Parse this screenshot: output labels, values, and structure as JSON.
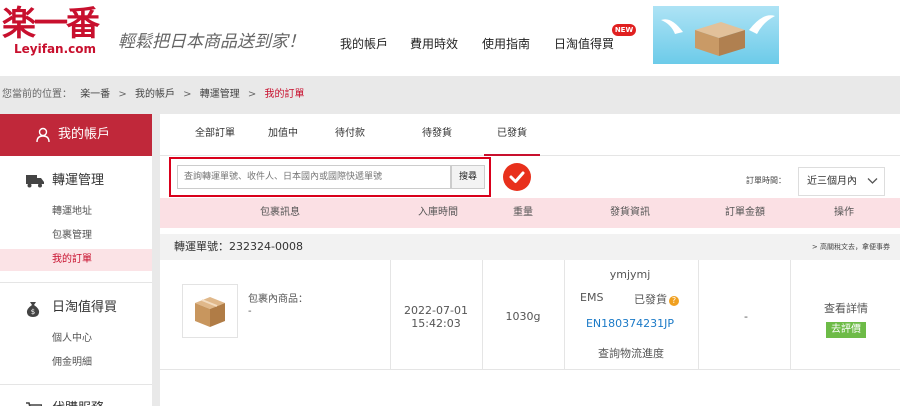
{
  "header": {
    "logo_cn": "楽一番",
    "logo_en": "Leyifan.com",
    "slogan": "輕鬆把日本商品送到家！",
    "nav": [
      {
        "label": "我的帳戶"
      },
      {
        "label": "費用時效"
      },
      {
        "label": "使用指南"
      },
      {
        "label": "日淘值得買"
      }
    ],
    "new_badge": "NEW"
  },
  "breadcrumb": {
    "prefix": "您當前的位置：",
    "items": [
      "楽一番",
      ">",
      "我的帳戶",
      ">",
      "轉運管理",
      ">",
      "我的訂單"
    ]
  },
  "sidebar": {
    "account_label": "我的帳戶",
    "sections": [
      {
        "label": "轉運管理",
        "items": [
          "轉運地址",
          "包裹管理",
          "我的訂單"
        ]
      },
      {
        "label": "日淘值得買",
        "items": [
          "個人中心",
          "佣金明細"
        ]
      },
      {
        "label": "代購服務"
      }
    ]
  },
  "tabs": [
    {
      "label": "全部訂單"
    },
    {
      "label": "加值中"
    },
    {
      "label": "待付款"
    },
    {
      "label": "待發貨"
    },
    {
      "label": "已發貨"
    }
  ],
  "search": {
    "placeholder": "查詢轉運單號、收件人、日本國內或國際快遞單號",
    "button": "搜尋"
  },
  "filter": {
    "label": "訂單時間：",
    "value": "近三個月內"
  },
  "table": {
    "columns": [
      "包裹訊息",
      "入庫時間",
      "重量",
      "發貨資訊",
      "訂單金額",
      "操作"
    ]
  },
  "order": {
    "number_label": "轉運單號：",
    "number": "232324-0008",
    "note": "> 高關稅文去，拿便事券",
    "package_label": "包裹內商品：",
    "package_value": "-",
    "date": "2022-07-01",
    "time": "15:42:03",
    "weight": "1030g",
    "receiver": "ymjymj",
    "carrier": "EMS",
    "status": "已發貨",
    "tracking": "EN180374231JP",
    "tracking_link": "查詢物流進度",
    "amount": "-",
    "details_link": "查看詳情",
    "review_button": "去評價"
  }
}
